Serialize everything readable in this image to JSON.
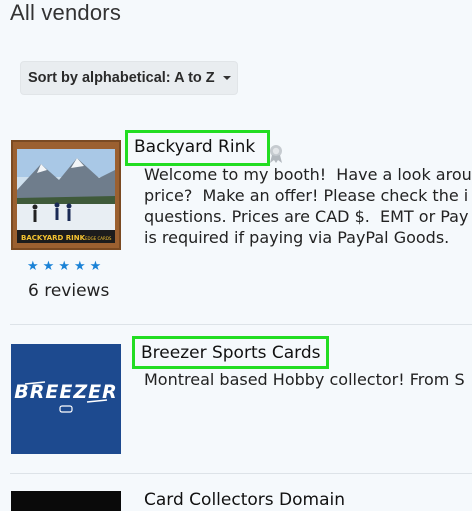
{
  "page": {
    "title": "All vendors"
  },
  "sort": {
    "label": "Sort by alphabetical: A to Z"
  },
  "vendors": [
    {
      "name": "Backyard Rink",
      "description": "Welcome to my booth!  Have a look arou\nprice?  Make an offer! Please check the i\nquestions. Prices are CAD $.  EMT or Pay\nis required if paying via PayPal Goods.",
      "rating": 5,
      "reviews": "6 reviews",
      "logo_text": "BACKYARD RINK",
      "logo_sub": "EDGE CARDS"
    },
    {
      "name": "Breezer Sports Cards",
      "description": "Montreal based Hobby collector! From S",
      "logo_text": "BREEZER"
    },
    {
      "name": "Card Collectors Domain"
    }
  ],
  "colors": {
    "highlight": "#22dd22",
    "star": "#1a82d6",
    "breezer_bg": "#1d4a8f"
  }
}
